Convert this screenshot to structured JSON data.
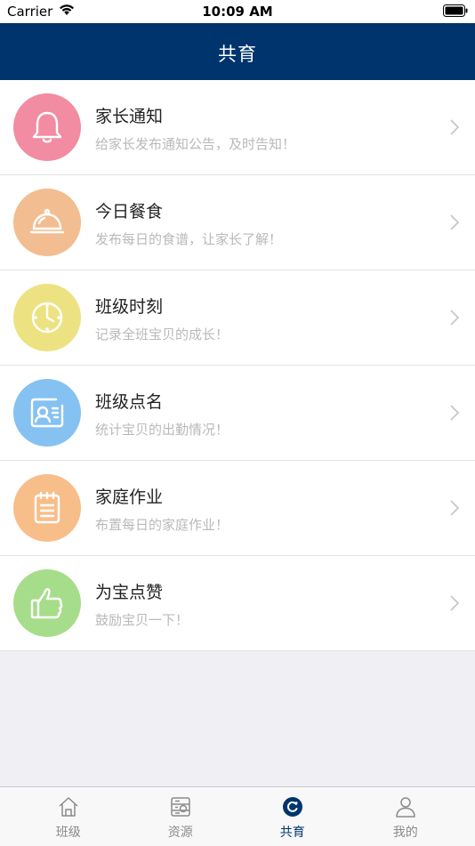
{
  "status_bar": {
    "carrier": "Carrier",
    "time": "10:09 AM"
  },
  "nav": {
    "title": "共育"
  },
  "colors": {
    "nav_bg": "#00346c",
    "bell": "#f28ca2",
    "dish": "#f2bd91",
    "clock": "#ede282",
    "rollcall": "#86c2f1",
    "homework": "#f8be8a",
    "thumb": "#a6dd8a"
  },
  "items": [
    {
      "title": "家长通知",
      "subtitle": "给家长发布通知公告，及时告知！",
      "icon": "bell-icon"
    },
    {
      "title": "今日餐食",
      "subtitle": "发布每日的食谱，让家长了解！",
      "icon": "dish-icon"
    },
    {
      "title": "班级时刻",
      "subtitle": "记录全班宝贝的成长！",
      "icon": "clock-icon"
    },
    {
      "title": "班级点名",
      "subtitle": "统计宝贝的出勤情况！",
      "icon": "rollcall-icon"
    },
    {
      "title": "家庭作业",
      "subtitle": "布置每日的家庭作业！",
      "icon": "notepad-icon"
    },
    {
      "title": "为宝点赞",
      "subtitle": "鼓励宝贝一下！",
      "icon": "thumbs-up-icon"
    }
  ],
  "tabs": [
    {
      "label": "班级",
      "icon": "home-icon",
      "active": false
    },
    {
      "label": "资源",
      "icon": "resource-icon",
      "active": false
    },
    {
      "label": "共育",
      "icon": "coeducation-icon",
      "active": true
    },
    {
      "label": "我的",
      "icon": "person-icon",
      "active": false
    }
  ]
}
